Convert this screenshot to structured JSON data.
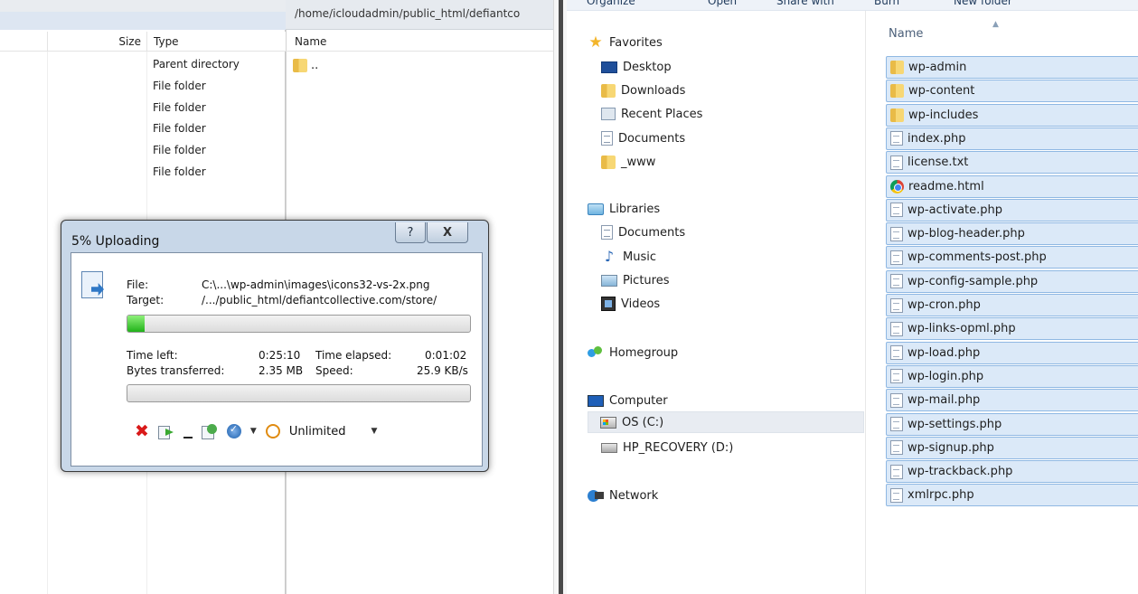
{
  "left_panel": {
    "columns": {
      "size": "Size",
      "type": "Type"
    },
    "rows": [
      {
        "type": "Parent directory"
      },
      {
        "type": "File folder"
      },
      {
        "type": "File folder"
      },
      {
        "type": "File folder"
      },
      {
        "type": "File folder"
      },
      {
        "type": "File folder"
      }
    ]
  },
  "remote_panel": {
    "path": "/home/icloudadmin/public_html/defiantco",
    "column_name": "Name",
    "parent_entry": ".."
  },
  "explorer": {
    "toolbar": [
      "Organize",
      "Open",
      "Share with",
      "Burn",
      "New folder"
    ],
    "nav": {
      "favorites": "Favorites",
      "favorites_items": [
        "Desktop",
        "Downloads",
        "Recent Places",
        "Documents",
        "_www"
      ],
      "libraries": "Libraries",
      "libraries_items": [
        "Documents",
        "Music",
        "Pictures",
        "Videos"
      ],
      "homegroup": "Homegroup",
      "computer": "Computer",
      "computer_items": [
        "OS (C:)",
        "HP_RECOVERY (D:)"
      ],
      "network": "Network"
    },
    "column_name": "Name",
    "files": [
      {
        "name": "wp-admin",
        "icon": "folder"
      },
      {
        "name": "wp-content",
        "icon": "folder"
      },
      {
        "name": "wp-includes",
        "icon": "folder"
      },
      {
        "name": "index.php",
        "icon": "php-file"
      },
      {
        "name": "license.txt",
        "icon": "text-file"
      },
      {
        "name": "readme.html",
        "icon": "chrome-html"
      },
      {
        "name": "wp-activate.php",
        "icon": "php-file"
      },
      {
        "name": "wp-blog-header.php",
        "icon": "php-file"
      },
      {
        "name": "wp-comments-post.php",
        "icon": "php-file"
      },
      {
        "name": "wp-config-sample.php",
        "icon": "php-file"
      },
      {
        "name": "wp-cron.php",
        "icon": "php-file"
      },
      {
        "name": "wp-links-opml.php",
        "icon": "php-file"
      },
      {
        "name": "wp-load.php",
        "icon": "php-file"
      },
      {
        "name": "wp-login.php",
        "icon": "php-file"
      },
      {
        "name": "wp-mail.php",
        "icon": "php-file"
      },
      {
        "name": "wp-settings.php",
        "icon": "php-file"
      },
      {
        "name": "wp-signup.php",
        "icon": "php-file"
      },
      {
        "name": "wp-trackback.php",
        "icon": "php-file"
      },
      {
        "name": "xmlrpc.php",
        "icon": "php-file"
      }
    ]
  },
  "dialog": {
    "title": "5% Uploading",
    "help": "?",
    "close": "X",
    "file_label": "File:",
    "file_value": "C:\\...\\wp-admin\\images\\icons32-vs-2x.png",
    "target_label": "Target:",
    "target_value": "/.../public_html/defiantcollective.com/store/",
    "file_progress": 0.05,
    "time_left_label": "Time left:",
    "time_left": "0:25:10",
    "time_elapsed_label": "Time elapsed:",
    "time_elapsed": "0:01:02",
    "bytes_label": "Bytes transferred:",
    "bytes": "2.35 MB",
    "speed_label": "Speed:",
    "speed": "25.9 KB/s",
    "total_progress": 0.0,
    "speed_limit": "Unlimited"
  }
}
